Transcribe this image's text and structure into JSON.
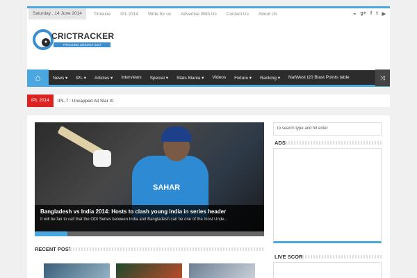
{
  "topbar": {
    "date": "Saturday , 14 June 2014",
    "links": [
      "Timeline",
      "IPL 2014",
      "Write for us",
      "Advertise With Us",
      "Contact Us",
      "About Us"
    ]
  },
  "logo": {
    "name": "CRICTRACKER",
    "tagline": "TRACKING CRICKET 24x7"
  },
  "nav": {
    "items": [
      "News ▾",
      "IPL ▾",
      "Articles ▾",
      "Interviews",
      "Special ▾",
      "Stats Mania ▾",
      "Videos",
      "Fixture ▾",
      "Ranking ▾",
      "NatWest t20 Blast Points table"
    ]
  },
  "ticker": {
    "label": "IPL 2014",
    "text": "IPL-7 : Uncapped All Star XI"
  },
  "slider": {
    "title": "Bangladesh vs India 2014: Hosts to clash young India in series header",
    "excerpt": "It will be fair to call that the ODI Series between India and Bangladesh can be one of the most Unde...",
    "jersey_text": "SAHAR"
  },
  "sections": {
    "recent_posts": "RECENT POSTS",
    "ads": "ADS",
    "live_score": "LIVE SCORE"
  },
  "search": {
    "placeholder": "to search type and hit enter"
  },
  "colors": {
    "accent": "#4aa7e0",
    "nav_bg": "#2c2c2c",
    "ticker_label": "#dd2222"
  }
}
